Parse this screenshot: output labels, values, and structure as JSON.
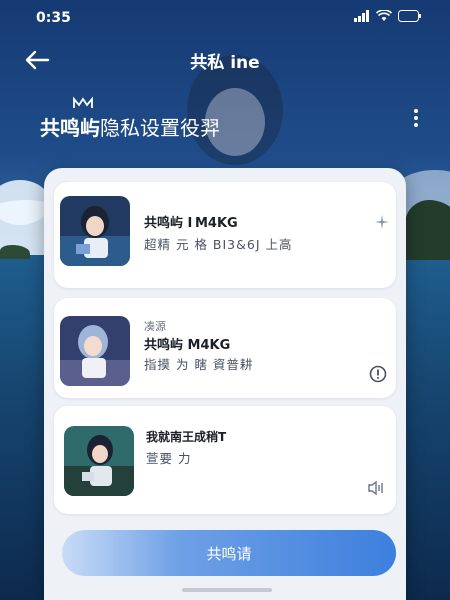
{
  "status_bar": {
    "time": "0:35"
  },
  "header": {
    "title": "共私 ine"
  },
  "page": {
    "heading_strong": "共鸣屿",
    "heading_rest": "隐私设置役羿"
  },
  "cards": [
    {
      "title": "共鸣屿 I M4KG",
      "subtitle": "超精 元 格 BI3&6J 上高"
    },
    {
      "label": "凑源",
      "title": "共鸣屿 M4KG",
      "subtitle": "指摸 为 瞎 資普耕"
    },
    {
      "title": "我就南王成稍T",
      "subtitle": "萱要 力"
    }
  ],
  "primary_button": {
    "label": "共鸣请"
  },
  "icons": {
    "back": "arrow-left-icon",
    "more": "kebab-menu-icon",
    "card1": "sparkle-icon",
    "card2": "info-icon",
    "card3": "speaker-icon"
  },
  "colors": {
    "accent": "#3d7fdd",
    "panel": "#eef1f6",
    "background": "#163a73"
  }
}
